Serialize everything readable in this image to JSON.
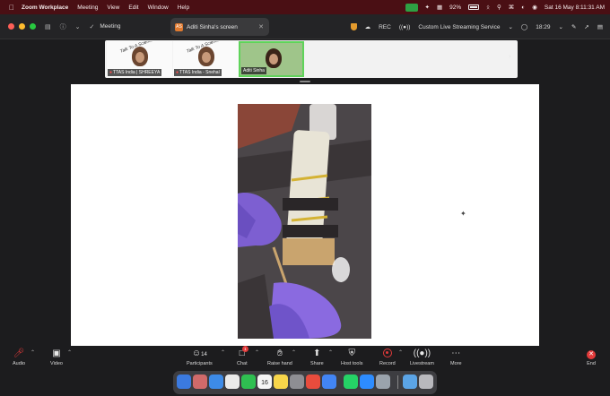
{
  "menubar": {
    "app_name": "Zoom Workplace",
    "items": [
      "Meeting",
      "View",
      "Edit",
      "Window",
      "Help"
    ],
    "battery": "92%",
    "datetime": "Sat 16 May  8:11:31 AM"
  },
  "titlebar": {
    "meeting_label": "Meeting",
    "tab_badge": "AS",
    "tab_title": "Aditi Sinha's screen",
    "rec_label": "REC",
    "streaming_label": "Custom Live Streaming Service",
    "timer": "18:29"
  },
  "thumbnails": [
    {
      "name": "TTAS India | SHREEYA",
      "logo": "Talk To A Scientist"
    },
    {
      "name": "TTAS India - Snehal",
      "logo": "Talk To A Scientist"
    },
    {
      "name": "Aditi Sinha",
      "logo": ""
    }
  ],
  "toolbar": {
    "audio": "Audio",
    "video": "Video",
    "participants": "Participants",
    "participants_count": "14",
    "chat": "Chat",
    "chat_badge": "1",
    "raise_hand": "Raise hand",
    "share": "Share",
    "host_tools": "Host tools",
    "record": "Record",
    "livestream": "Livestream",
    "more": "More",
    "end": "End"
  },
  "dock": {
    "calendar_day": "16"
  },
  "colors": {
    "menubar_bg": "#4a0f14",
    "active_thumb_border": "#5fd35a",
    "record_red": "#e23a3a",
    "glove_purple": "#7d5fd1"
  }
}
